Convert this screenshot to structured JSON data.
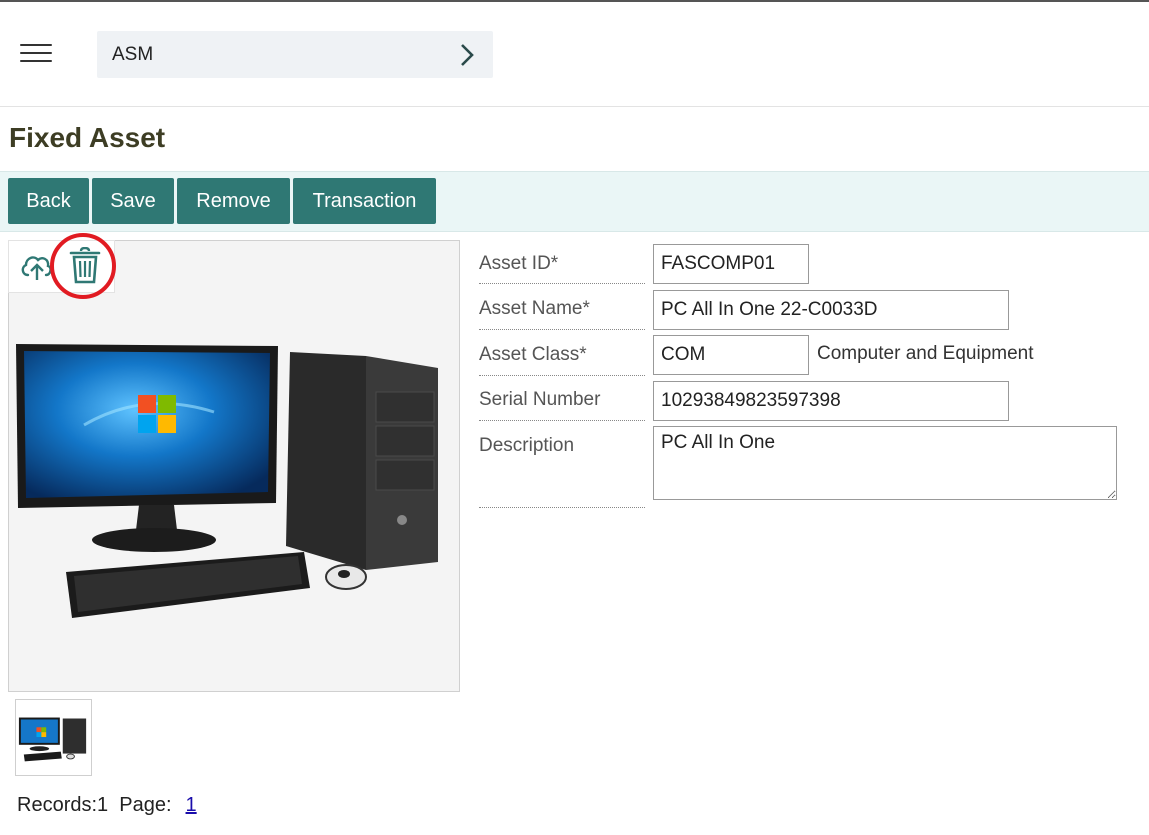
{
  "breadcrumb": {
    "label": "ASM"
  },
  "page": {
    "title": "Fixed Asset"
  },
  "toolbar": {
    "back": "Back",
    "save": "Save",
    "remove": "Remove",
    "transaction": "Transaction"
  },
  "icons": {
    "menu": "hamburger-menu-icon",
    "chevron": "chevron-right-icon",
    "upload": "cloud-upload-icon",
    "trash": "trash-icon"
  },
  "colors": {
    "accent": "#2f7874",
    "highlight": "#e11b22",
    "toolbar_bg": "#eaf6f6"
  },
  "form": {
    "asset_id": {
      "label": "Asset ID*",
      "value": "FASCOMP01"
    },
    "asset_name": {
      "label": "Asset Name*",
      "value": "PC All In One 22-C0033D"
    },
    "asset_class": {
      "label": "Asset Class*",
      "value": "COM",
      "description": "Computer and Equipment"
    },
    "serial_number": {
      "label": "Serial Number",
      "value": "10293849823597398"
    },
    "description": {
      "label": "Description",
      "value": "PC All In One"
    }
  },
  "pager": {
    "records_text": "Records:1  Page:",
    "page_link": "1"
  }
}
